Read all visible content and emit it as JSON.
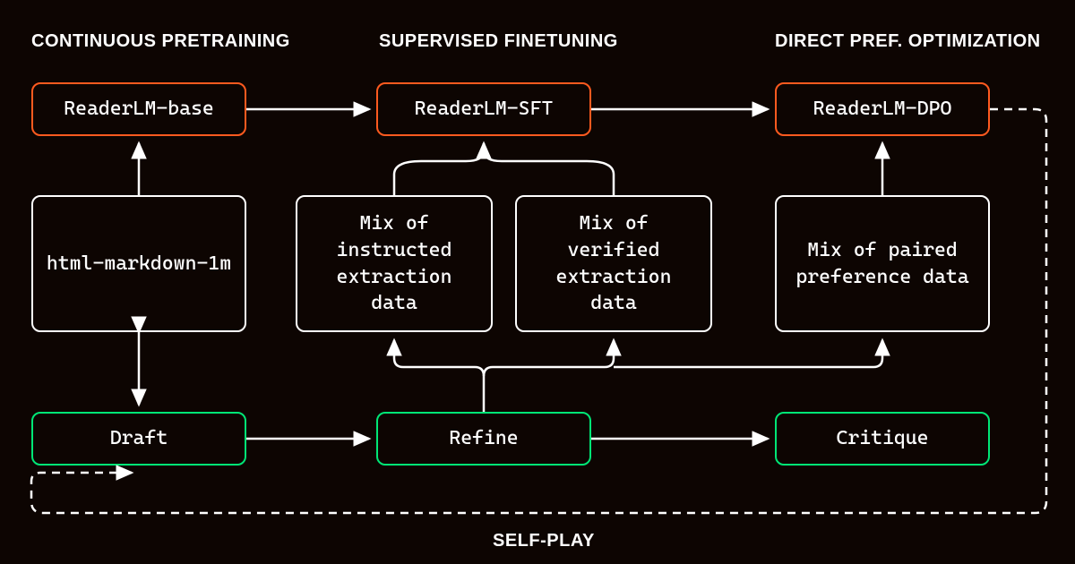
{
  "headings": {
    "pretraining": "Continuous Pretraining",
    "sft": "Supervised Finetuning",
    "dpo": "Direct Pref. Optimization",
    "selfplay": "Self-Play"
  },
  "boxes": {
    "readerlm_base": "ReaderLM-base",
    "readerlm_sft": "ReaderLM-SFT",
    "readerlm_dpo": "ReaderLM-DPO",
    "html_md": "html-markdown-1m",
    "mix_instructed": "Mix of instructed extraction data",
    "mix_verified": "Mix of verified extraction data",
    "mix_paired": "Mix of paired preference data",
    "draft": "Draft",
    "refine": "Refine",
    "critique": "Critique"
  }
}
